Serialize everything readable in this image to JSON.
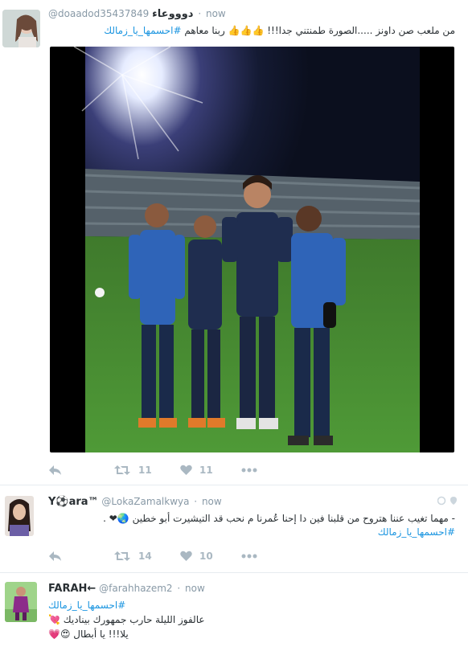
{
  "tweets": [
    {
      "name": "دوووعاء",
      "handle": "@doaadod35437849",
      "time": "now",
      "text": "من ملعب صن داونز .....الصورة طمنتني جدا!!! 👍👍👍 ربنا معاهم",
      "hashtag": "#احسمها_يا_زمالك",
      "retweets": "11",
      "likes": "11"
    },
    {
      "name": "Y⚽ara™",
      "handle": "@LokaZamalkwya",
      "time": "now",
      "text": "- مهما تغيب عننا هتروح من قلبنا فين دا إحنا عُمرنا م نحب قد التيشيرت أبو خطين 🌏❤ .",
      "hashtag": "#احسمها_يا_زمالك",
      "retweets": "14",
      "likes": "10"
    },
    {
      "name": "FARAH←",
      "handle": "@farahhazem2",
      "time": "now",
      "hashtag": "#احسمها_يا_زمالك",
      "line1": "عالفوز الليلة حارب جمهورك بيناديك 💘",
      "line2": "يلا!!! يا أبطال 😍💗"
    }
  ],
  "dot": "·",
  "colors": {
    "hashtag": "#1b95e0",
    "muted": "#8899a6",
    "action": "#aab8c2"
  },
  "icons": [
    "reply-icon",
    "retweet-icon",
    "like-icon",
    "more-icon",
    "globe-icon",
    "location-icon"
  ]
}
